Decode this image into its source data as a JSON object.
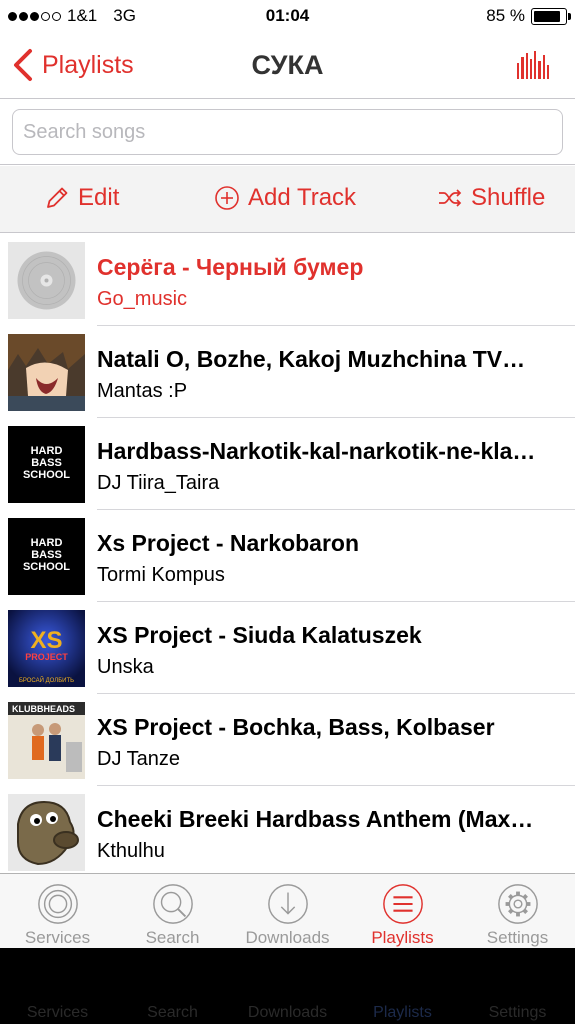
{
  "status_bar": {
    "carrier": "1&1",
    "network": "3G",
    "time": "01:04",
    "battery": "85 %",
    "battery_level": 0.85
  },
  "nav": {
    "back_label": "Playlists",
    "title": "СУКА"
  },
  "search": {
    "placeholder": "Search songs"
  },
  "toolbar": {
    "edit_label": "Edit",
    "add_label": "Add Track",
    "shuffle_label": "Shuffle"
  },
  "tracks": [
    {
      "title": "Серёга - Черный бумер",
      "artist": "Go_music",
      "playing": true
    },
    {
      "title": "Natali O, Bozhe, Kakoj Muzhchina TV…",
      "artist": "Mantas :P"
    },
    {
      "title": "Hardbass-Narkotik-kal-narkotik-ne-kla…",
      "artist": "DJ Tiira_Taira"
    },
    {
      "title": "Xs Project - Narkobaron",
      "artist": "Tormi Kompus"
    },
    {
      "title": "XS Project - Siuda Kalatuszek",
      "artist": "Unska"
    },
    {
      "title": "XS Project - Bochka, Bass, Kolbaser",
      "artist": "DJ Tanze"
    },
    {
      "title": "Cheeki Breeki Hardbass Anthem (Max…",
      "artist": "Kthulhu"
    }
  ],
  "art_text": {
    "hardbass": [
      "HARD",
      "BASS",
      "SCHOOL"
    ],
    "xs": "XS",
    "xs_sub": "PROJECT",
    "xs_bottom": "БРОСАЙ ДОЛБИТЬ",
    "klubbheads": "KLUBBHEADS"
  },
  "tabs": [
    {
      "label": "Services",
      "icon": "services-icon"
    },
    {
      "label": "Search",
      "icon": "search-icon"
    },
    {
      "label": "Downloads",
      "icon": "download-icon"
    },
    {
      "label": "Playlists",
      "icon": "playlists-icon",
      "active": true
    },
    {
      "label": "Settings",
      "icon": "gear-icon"
    }
  ],
  "colors": {
    "accent": "#e0312d",
    "inactive": "#9a9a9a"
  }
}
